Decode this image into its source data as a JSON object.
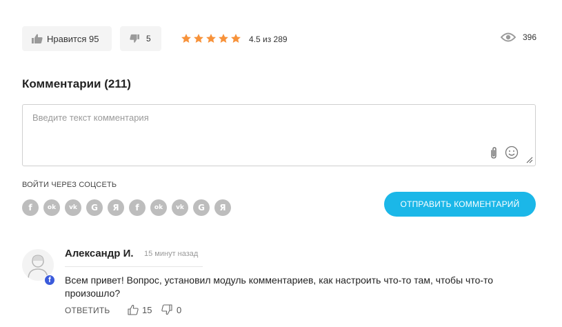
{
  "reactions": {
    "like_label": "Нравится",
    "like_count": "95",
    "dislike_count": "5"
  },
  "rating": {
    "stars_filled": 5,
    "stars_total": 5,
    "text": "4.5 из 289",
    "star_color": "#f7923a"
  },
  "views": {
    "count": "396",
    "icon": "eye-icon"
  },
  "comments": {
    "title": "Комментарии (211)",
    "input_placeholder": "Введите текст комментария",
    "input_value": "",
    "social_label": "ВОЙТИ ЧЕРЕЗ СОЦСЕТЬ",
    "social_buttons": [
      {
        "glyph": "f",
        "icon": "facebook-icon"
      },
      {
        "glyph": "ok",
        "icon": "odnoklassniki-icon"
      },
      {
        "glyph": "vk",
        "icon": "vk-icon"
      },
      {
        "glyph": "G",
        "icon": "google-icon"
      },
      {
        "glyph": "Я",
        "icon": "yandex-icon"
      },
      {
        "glyph": "f",
        "icon": "facebook-icon"
      },
      {
        "glyph": "ok",
        "icon": "odnoklassniki-icon"
      },
      {
        "glyph": "vk",
        "icon": "vk-icon"
      },
      {
        "glyph": "G",
        "icon": "google-icon"
      },
      {
        "glyph": "Я",
        "icon": "yandex-icon"
      }
    ],
    "send_label": "ОТПРАВИТЬ КОММЕНТАРИЙ",
    "send_color": "#1bb7e8"
  },
  "comment": {
    "author": "Александр И.",
    "time": "15 минут назад",
    "text": "Всем привет! Вопрос, установил модуль комментариев, как настроить что-то там, чтобы что-то произошло?",
    "reply_label": "ОТВЕТИТЬ",
    "likes": "15",
    "dislikes": "0",
    "source_badge": "f",
    "badge_color": "#3b5bdb"
  }
}
